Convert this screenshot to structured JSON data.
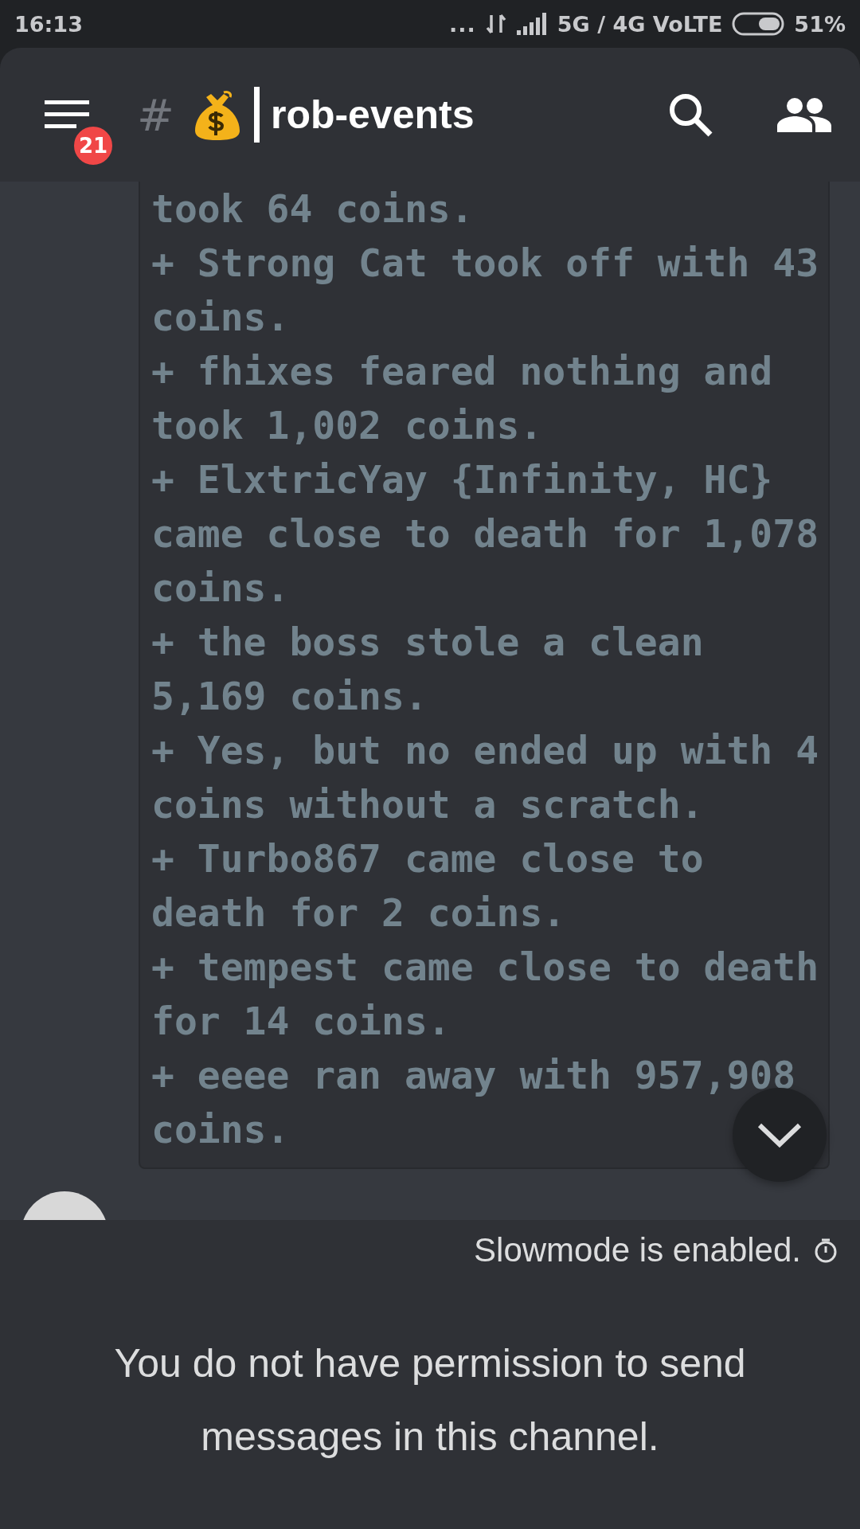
{
  "status_bar": {
    "time": "16:13",
    "dots": "...",
    "network": "5G / 4G VoLTE",
    "battery": "51%"
  },
  "header": {
    "unread_badge": "21",
    "hash": "#",
    "channel_name": "rob-events"
  },
  "code_lines": [
    "took 64 coins.",
    "+ Strong Cat took off with 43",
    "coins.",
    "+ fhixes feared nothing and",
    "took 1,002 coins.",
    "+ ElxtricYay {Infinity, HC}",
    "came close to death for 1,078",
    "coins.",
    "+ the boss stole a clean",
    "5,169 coins.",
    "+ Yes, but no ended up with 4",
    "coins without a scratch.",
    "+ Turbo867 came close to",
    "death for 2 coins.",
    "+ tempest came close to death",
    "for 14 coins.",
    "+ eeee ran away with 957,908",
    "coins."
  ],
  "footer": {
    "slowmode": "Slowmode is enabled.",
    "notice": "You do not have permission to send messages in this channel."
  }
}
